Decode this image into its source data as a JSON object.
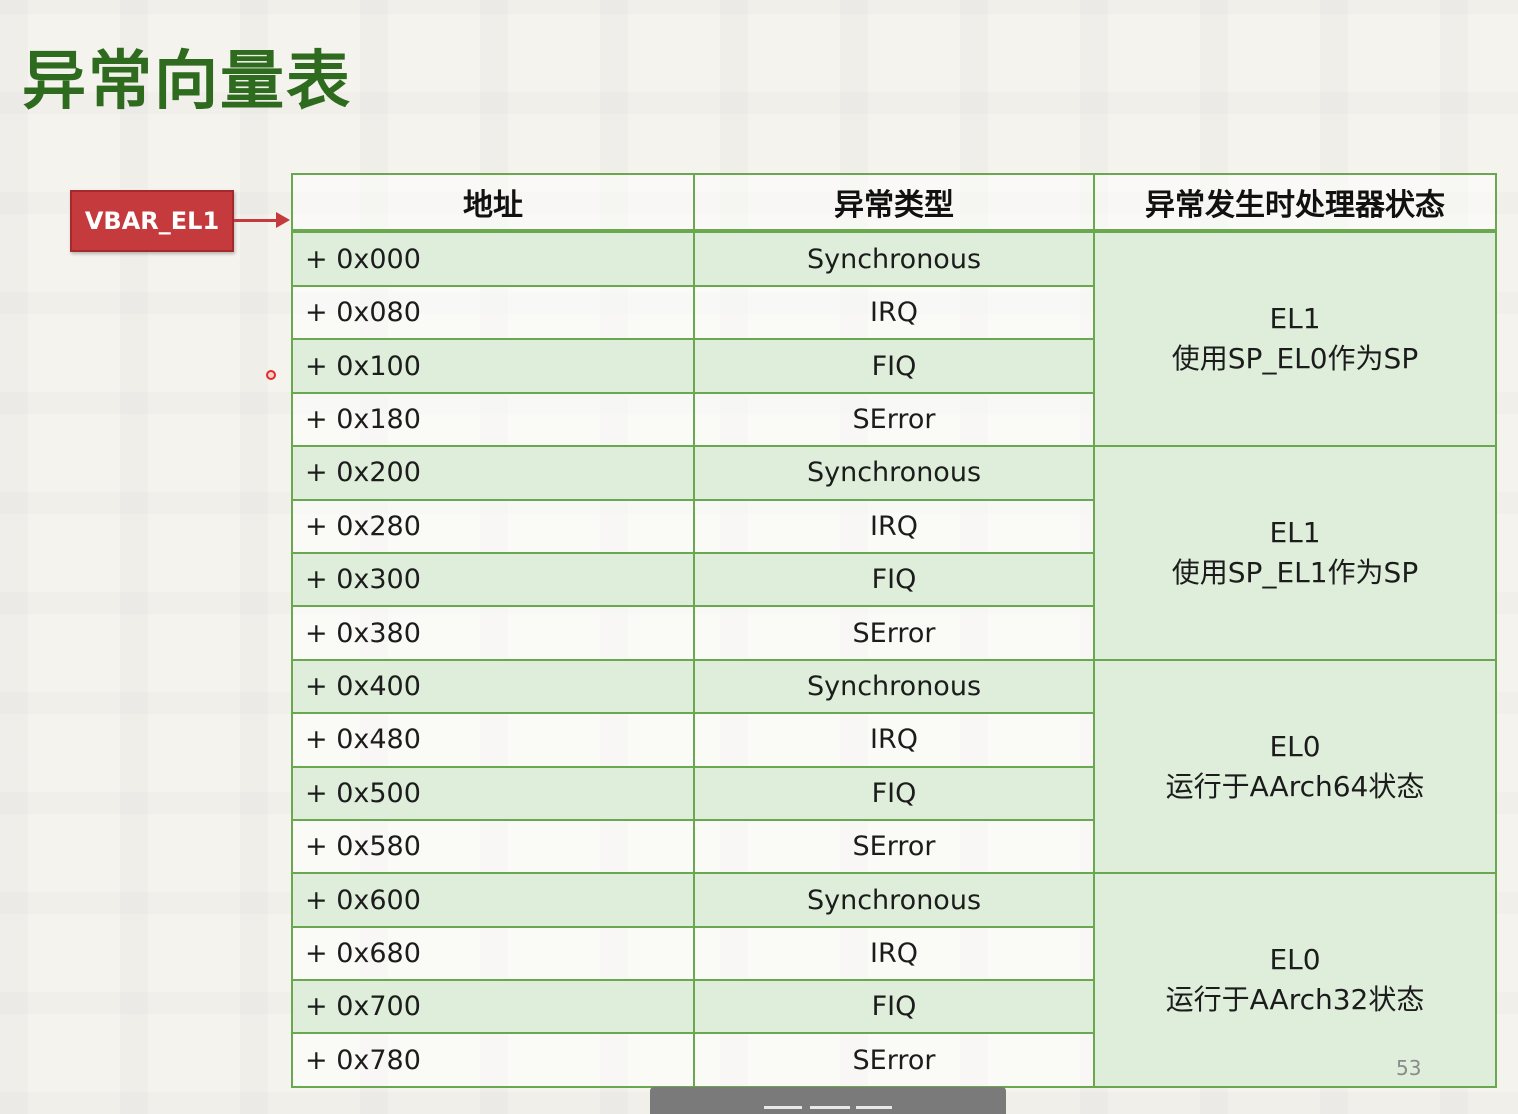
{
  "slide": {
    "title": "异常向量表",
    "base_register": "VBAR_EL1",
    "page_number": "53"
  },
  "table": {
    "headers": [
      "地址",
      "异常类型",
      "异常发生时处理器状态"
    ],
    "groups": [
      {
        "state_line1": "EL1",
        "state_line2": "使用SP_EL0作为SP",
        "rows": [
          {
            "addr": "+ 0x000",
            "type": "Synchronous"
          },
          {
            "addr": "+ 0x080",
            "type": "IRQ"
          },
          {
            "addr": "+ 0x100",
            "type": "FIQ"
          },
          {
            "addr": "+ 0x180",
            "type": "SError"
          }
        ]
      },
      {
        "state_line1": "EL1",
        "state_line2": "使用SP_EL1作为SP",
        "rows": [
          {
            "addr": "+ 0x200",
            "type": "Synchronous"
          },
          {
            "addr": "+ 0x280",
            "type": "IRQ"
          },
          {
            "addr": "+ 0x300",
            "type": "FIQ"
          },
          {
            "addr": "+ 0x380",
            "type": "SError"
          }
        ]
      },
      {
        "state_line1": "EL0",
        "state_line2": "运行于AArch64状态",
        "rows": [
          {
            "addr": "+ 0x400",
            "type": "Synchronous"
          },
          {
            "addr": "+ 0x480",
            "type": "IRQ"
          },
          {
            "addr": "+ 0x500",
            "type": "FIQ"
          },
          {
            "addr": "+ 0x580",
            "type": "SError"
          }
        ]
      },
      {
        "state_line1": "EL0",
        "state_line2": "运行于AArch32状态",
        "rows": [
          {
            "addr": "+ 0x600",
            "type": "Synchronous"
          },
          {
            "addr": "+ 0x680",
            "type": "IRQ"
          },
          {
            "addr": "+ 0x700",
            "type": "FIQ"
          },
          {
            "addr": "+ 0x780",
            "type": "SError"
          }
        ]
      }
    ]
  },
  "colors": {
    "title": "#2f6b1e",
    "register_box": "#c43a3d",
    "table_border": "#6aa84f",
    "row_shade": "#dfeedb"
  }
}
